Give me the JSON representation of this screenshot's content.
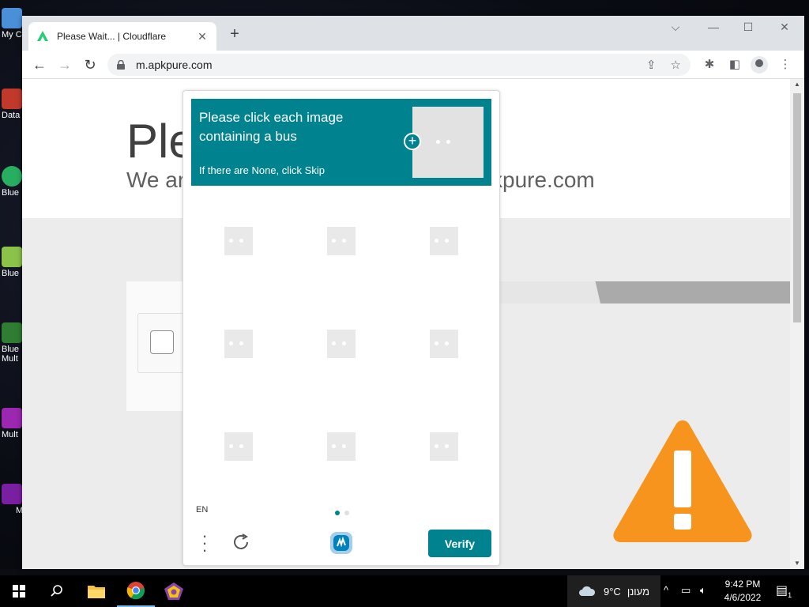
{
  "desktop": {
    "icons": [
      {
        "label": "My C",
        "color": "#4a90d9"
      },
      {
        "label": "Data",
        "color": "#c0392b"
      },
      {
        "label": "Blue",
        "color": "#27ae60"
      },
      {
        "label": "Blue",
        "color": "#8bc34a"
      },
      {
        "label": "Blue\nMult",
        "color": "#2e7d32"
      },
      {
        "label": "Mult",
        "color": "#9c27b0"
      },
      {
        "label": "M",
        "color": "#7b1fa2"
      }
    ]
  },
  "browser": {
    "tab_title": "Please Wait... | Cloudflare",
    "tab_close": "✕",
    "new_tab": "+",
    "url": "m.apkpure.com",
    "window_controls": {
      "dropdown": "⌵",
      "minimize": "—",
      "maximize": "☐",
      "close": "✕"
    },
    "nav": {
      "back": "←",
      "forward": "→",
      "reload": "↻"
    },
    "icons": {
      "share": "⇪",
      "bookmark": "☆",
      "extensions": "✱",
      "sidepanel": "◧",
      "menu": "⋮"
    }
  },
  "page": {
    "title_partial": "Ple",
    "subtitle_left": "We ar",
    "subtitle_right": "kpure.com",
    "accent_warning": "#f7941d"
  },
  "captcha": {
    "prompt": "Please click each image containing a bus",
    "hint": "If there are None, click Skip",
    "language": "EN",
    "verify_label": "Verify",
    "accent": "#00838f",
    "grid_rows": 3,
    "grid_cols": 3,
    "pages": 2,
    "active_page": 1
  },
  "taskbar": {
    "weather_temp": "9°C",
    "weather_text": "מעונן",
    "time": "9:42 PM",
    "date": "4/6/2022",
    "notification_count": "1"
  }
}
